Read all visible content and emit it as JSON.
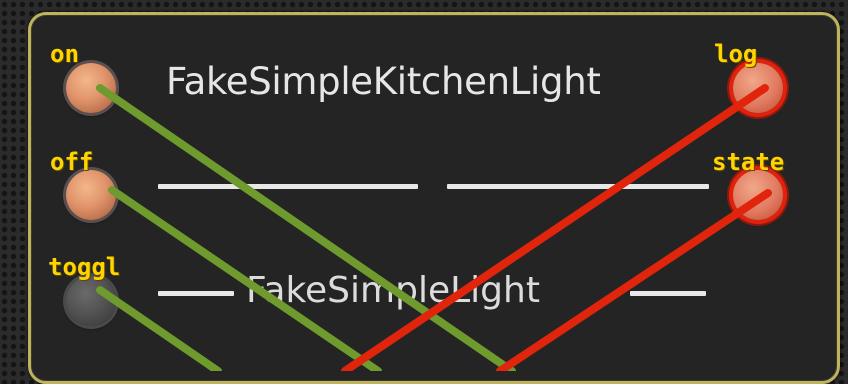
{
  "node": {
    "title": "FakeSimpleKitchenLight",
    "subtitle": "FakeSimpleLight"
  },
  "inputs": [
    {
      "label": "on",
      "state": "active"
    },
    {
      "label": "off",
      "state": "active"
    },
    {
      "label": "toggl",
      "state": "inactive"
    }
  ],
  "outputs": [
    {
      "label": "log"
    },
    {
      "label": "state"
    }
  ],
  "colors": {
    "input_wire": "#6e9a2e",
    "output_wire": "#e0250c",
    "port_label": "#ffd400",
    "node_border": "#bfb45c",
    "node_background": "#242424"
  }
}
